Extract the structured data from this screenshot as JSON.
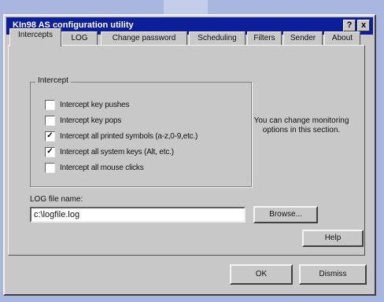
{
  "window": {
    "title": "KIn98 AS configuration utility",
    "help_glyph": "?",
    "close_glyph": "x"
  },
  "tabs": [
    {
      "label": "Intercepts",
      "active": true
    },
    {
      "label": "LOG"
    },
    {
      "label": "Change password"
    },
    {
      "label": "Scheduling"
    },
    {
      "label": "Filters"
    },
    {
      "label": "Sender"
    },
    {
      "label": "About"
    }
  ],
  "intercept": {
    "group_label": "Intercept",
    "options": [
      {
        "label": "Intercept key pushes",
        "checked": false
      },
      {
        "label": "Intercept key pops",
        "checked": false
      },
      {
        "label": "Intercept all printed symbols (a-z,0-9,etc.)",
        "checked": true
      },
      {
        "label": "Intercept all system keys (Alt, etc.)",
        "checked": true
      },
      {
        "label": "Intercept all mouse clicks",
        "checked": false
      }
    ]
  },
  "hint": "You can change monitoring options in this section.",
  "log": {
    "label": "LOG file name:",
    "value": "c:\\logfile.log",
    "browse_label": "Browse..."
  },
  "help_label": "Help",
  "ok_label": "OK",
  "dismiss_label": "Dismiss"
}
